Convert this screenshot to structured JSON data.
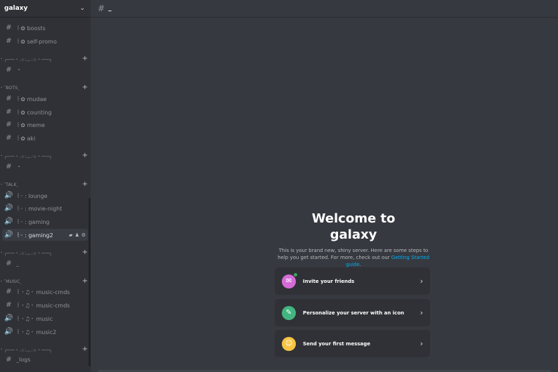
{
  "server": {
    "name": "galaxy"
  },
  "sidebar": {
    "items": [
      {
        "kind": "text",
        "label": "꒰✿ boosts",
        "selected": false
      },
      {
        "kind": "text",
        "label": "꒰✿ self-promo",
        "selected": false
      },
      {
        "kind": "category",
        "label": "┌───・.☆:.｡.:☆・───┐"
      },
      {
        "kind": "text",
        "label": "・",
        "selected": false
      },
      {
        "kind": "category",
        "label": "˹BOTS˼"
      },
      {
        "kind": "text",
        "label": "꒰✿ mudae",
        "selected": false
      },
      {
        "kind": "text",
        "label": "꒰✿ counting",
        "selected": false
      },
      {
        "kind": "text",
        "label": "꒰✿ meme",
        "selected": false
      },
      {
        "kind": "text",
        "label": "꒰✿ aki",
        "selected": false
      },
      {
        "kind": "category",
        "label": "┌───・.☆:.｡.:☆・───┐"
      },
      {
        "kind": "text",
        "label": "・",
        "selected": false
      },
      {
        "kind": "category",
        "label": "˹TALK˼"
      },
      {
        "kind": "voice",
        "label": "꒰ᵕ : lounge",
        "selected": false
      },
      {
        "kind": "voice",
        "label": "꒰ᵕ : movie-night",
        "selected": false
      },
      {
        "kind": "voice",
        "label": "꒰ᵕ : gaming",
        "selected": false
      },
      {
        "kind": "voice",
        "label": "꒰ᵕ : gaming2",
        "selected": true
      },
      {
        "kind": "category",
        "label": "┌───・.☆:.｡.:☆・───┐"
      },
      {
        "kind": "text",
        "label": "_",
        "selected": false
      },
      {
        "kind": "category",
        "label": "˹MUSIC˼"
      },
      {
        "kind": "text",
        "label": "꒰・♫・ music-cmds",
        "selected": false
      },
      {
        "kind": "text",
        "label": "꒰・♫・ music-cmds",
        "selected": false
      },
      {
        "kind": "voice",
        "label": "꒰・♫・ music",
        "selected": false
      },
      {
        "kind": "voice",
        "label": "꒰・♫・ music2",
        "selected": false
      },
      {
        "kind": "category",
        "label": "┌───・.☆:.｡.:☆・───┐"
      },
      {
        "kind": "text",
        "label": "_logs",
        "selected": false
      }
    ]
  },
  "topbar": {
    "channel_name": "_"
  },
  "welcome": {
    "title_line1": "Welcome to",
    "title_line2": "galaxy",
    "text": "This is your brand new, shiny server. Here are some steps to help you get started. For more, check out our ",
    "link": "Getting Started guide",
    "text_end": "."
  },
  "cards": [
    {
      "label": "Invite your friends",
      "icon": "invite-friends-icon",
      "color": "#d66bd8"
    },
    {
      "label": "Personalize your server with an icon",
      "icon": "personalize-icon",
      "color": "#43b581"
    },
    {
      "label": "Send your first message",
      "icon": "message-icon",
      "color": "#f6c343"
    }
  ],
  "colors": {
    "sidebar": "#2f3136",
    "main": "#36393f",
    "link": "#00aff4",
    "selected": "#393c43"
  }
}
